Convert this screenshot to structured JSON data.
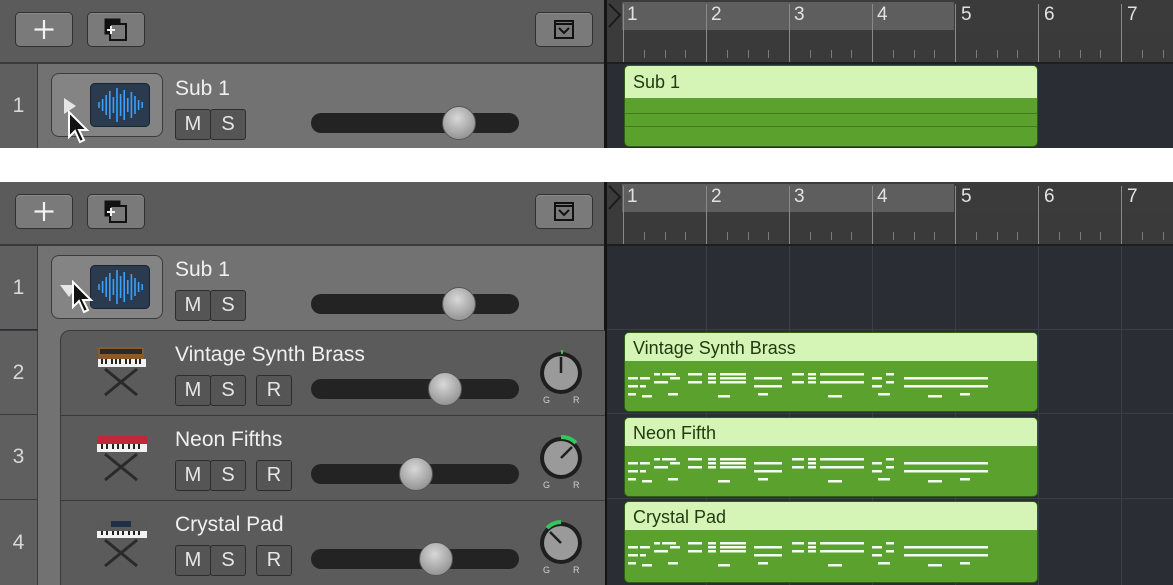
{
  "ruler": {
    "bars": [
      "1",
      "2",
      "3",
      "4",
      "5",
      "6",
      "7"
    ]
  },
  "top": {
    "track": {
      "number": "1",
      "name": "Sub 1",
      "mute": "M",
      "solo": "S"
    },
    "region": {
      "name": "Sub 1"
    }
  },
  "bottom": {
    "tracks": [
      {
        "number": "1",
        "name": "Sub 1",
        "mute": "M",
        "solo": "S"
      },
      {
        "number": "2",
        "name": "Vintage Synth Brass",
        "mute": "M",
        "solo": "S",
        "record": "R",
        "gain_label": "G",
        "reverb_label": "R"
      },
      {
        "number": "3",
        "name": "Neon Fifths",
        "mute": "M",
        "solo": "S",
        "record": "R",
        "gain_label": "G",
        "reverb_label": "R"
      },
      {
        "number": "4",
        "name": "Crystal Pad",
        "mute": "M",
        "solo": "S",
        "record": "R",
        "gain_label": "G",
        "reverb_label": "R"
      }
    ],
    "regions": [
      "Vintage Synth Brass",
      "Neon Fifth",
      "Crystal Pad"
    ]
  },
  "colors": {
    "region_fill": "#5aa12e",
    "region_header": "#d4f5b6",
    "audio_wave": "#3aa0ff"
  },
  "icons": [
    "add-track-icon",
    "duplicate-track-icon",
    "collapse-icon",
    "disclosure-triangle-icon",
    "audio-waveform-icon",
    "synth-keyboard-icon",
    "cursor-pointer-icon"
  ]
}
